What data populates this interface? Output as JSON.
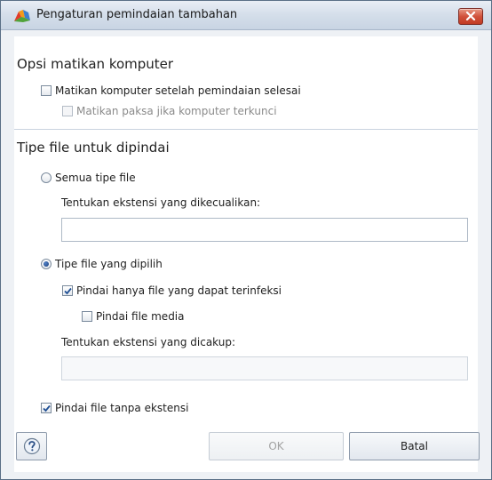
{
  "window": {
    "title": "Pengaturan pemindaian tambahan"
  },
  "sections": {
    "shutdown": {
      "title": "Opsi matikan komputer",
      "shutdown_after_scan": {
        "label": "Matikan komputer setelah pemindaian selesai",
        "checked": false
      },
      "force_shutdown_locked": {
        "label": "Matikan paksa jika komputer terkunci",
        "checked": false,
        "enabled": false
      }
    },
    "file_types": {
      "title": "Tipe file untuk dipindai",
      "all_types": {
        "label": "Semua tipe file",
        "selected": false
      },
      "excluded_ext_label": "Tentukan ekstensi yang dikecualikan:",
      "excluded_ext_value": "",
      "selected_types": {
        "label": "Tipe file yang dipilih",
        "selected": true
      },
      "infectable_only": {
        "label": "Pindai hanya file yang dapat terinfeksi",
        "checked": true
      },
      "scan_media": {
        "label": "Pindai file media",
        "checked": false
      },
      "included_ext_label": "Tentukan ekstensi yang dicakup:",
      "included_ext_value": "",
      "no_extension": {
        "label": "Pindai file tanpa ekstensi",
        "checked": true
      }
    }
  },
  "footer": {
    "help_icon": "question-mark",
    "ok_label": "OK",
    "cancel_label": "Batal"
  }
}
